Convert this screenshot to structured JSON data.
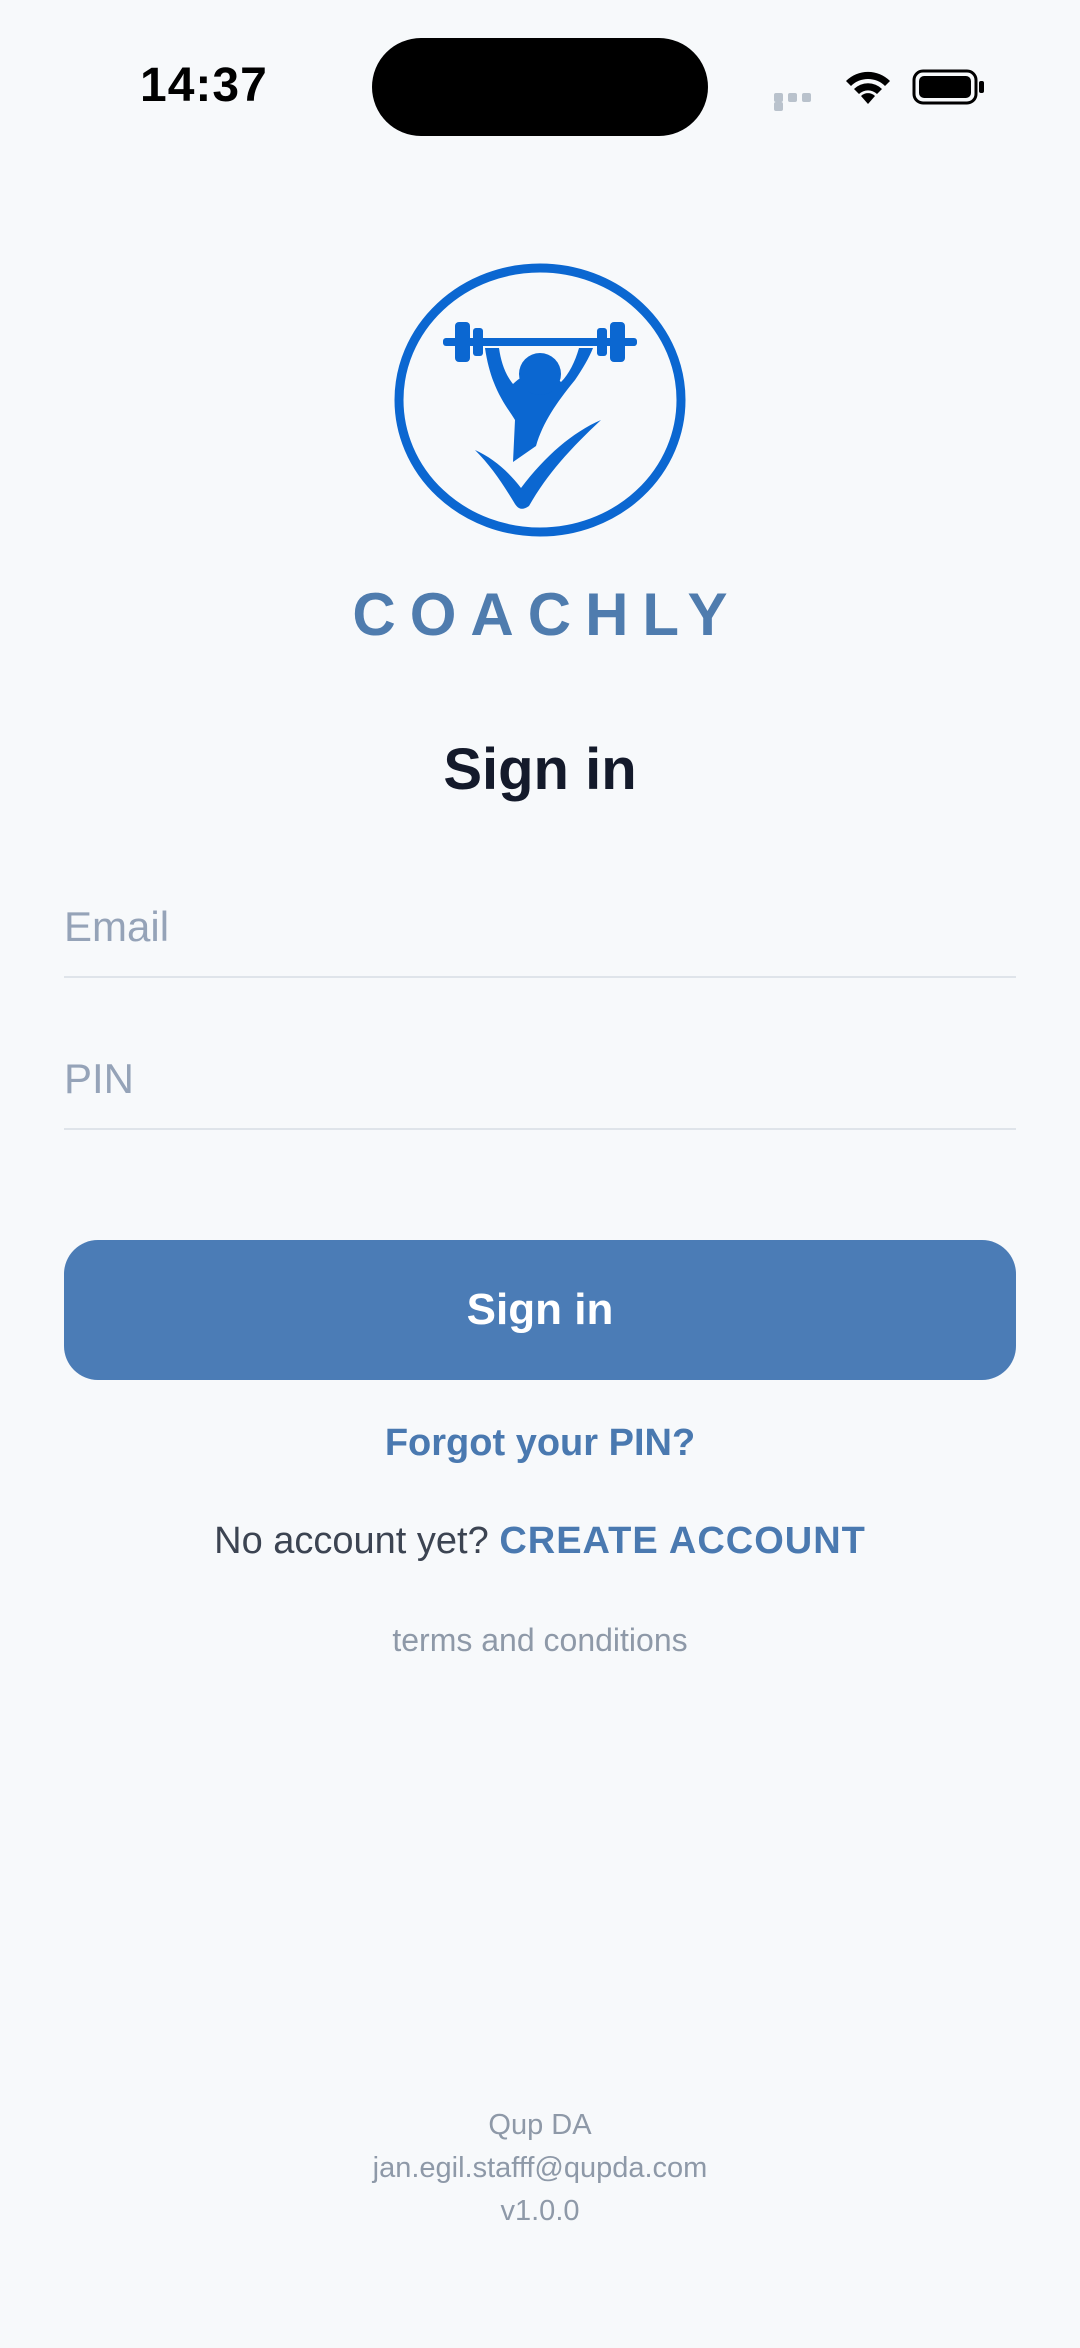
{
  "status_bar": {
    "time": "14:37",
    "icons": [
      "cellular-signal-icon",
      "wifi-icon",
      "battery-icon"
    ]
  },
  "brand": {
    "name": "COACHLY",
    "logo_icon": "weightlifter-checkmark-logo",
    "logo_color": "#0b67d1",
    "text_color": "#4f7cae"
  },
  "page": {
    "title": "Sign in"
  },
  "form": {
    "email_placeholder": "Email",
    "email_value": "",
    "pin_placeholder": "PIN",
    "pin_value": "",
    "submit_label": "Sign in",
    "submit_color": "#4b7cb6"
  },
  "links": {
    "forgot_pin": "Forgot your PIN?",
    "no_account_prompt": "No account yet?",
    "create_account": "CREATE ACCOUNT",
    "terms": "terms and conditions"
  },
  "footer": {
    "company": "Qup DA",
    "email": "jan.egil.stafff@qupda.com",
    "version": "v1.0.0"
  }
}
